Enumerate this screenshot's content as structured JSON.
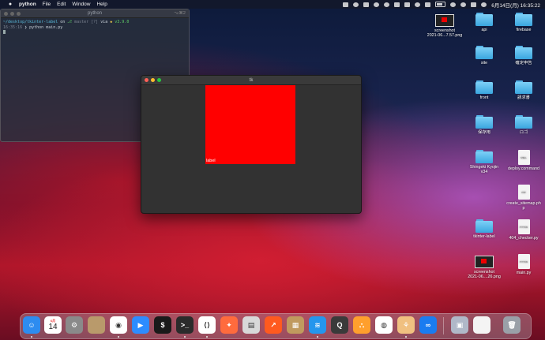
{
  "menubar": {
    "app_name": "python",
    "menus": [
      "File",
      "Edit",
      "Window",
      "Help"
    ],
    "clock": "6月14日(月)  16:35:22"
  },
  "terminal": {
    "title": "python",
    "shortcut": "⌥⌘2",
    "line1_path": "~/desktop/tkinter-label",
    "line1_on": " on ",
    "line1_branch": "master",
    "line1_flag": " [?]",
    "line1_via": " via ",
    "line1_version": "v3.9.0",
    "line2_time": "16:35:16",
    "line2_cmd": " ❯ python main.py"
  },
  "tk_window": {
    "title": "tk",
    "label_text": "label"
  },
  "desktop_icons": [
    {
      "name": "screenshot-file",
      "label": "screenshot\n2021-06...7.57.png",
      "kind": "shot",
      "col": 0,
      "row": 0
    },
    {
      "name": "folder-api",
      "label": "api",
      "kind": "folder",
      "col": 1,
      "row": 0
    },
    {
      "name": "folder-firebase",
      "label": "firebase",
      "kind": "folder",
      "col": 2,
      "row": 0
    },
    {
      "name": "folder-site",
      "label": "site",
      "kind": "folder",
      "col": 1,
      "row": 1
    },
    {
      "name": "folder-kakutei",
      "label": "確定申告",
      "kind": "folder",
      "col": 2,
      "row": 1
    },
    {
      "name": "folder-front",
      "label": "front",
      "kind": "folder",
      "col": 1,
      "row": 2
    },
    {
      "name": "folder-seikyu",
      "label": "請求書",
      "kind": "folder",
      "col": 2,
      "row": 2
    },
    {
      "name": "folder-hozon",
      "label": "保存用",
      "kind": "folder",
      "col": 1,
      "row": 3
    },
    {
      "name": "folder-logo",
      "label": "ロゴ",
      "kind": "folder",
      "col": 2,
      "row": 3
    },
    {
      "name": "folder-shingeki",
      "label": "Shingeki Kyojin\nv34",
      "kind": "folder",
      "col": 1,
      "row": 4
    },
    {
      "name": "file-deploy-command",
      "label": "deploy.command",
      "kind": "doc",
      "tag": "SHELL",
      "col": 2,
      "row": 4
    },
    {
      "name": "file-create-sitemap",
      "label": "create_sitemap.ph\np",
      "kind": "doc",
      "tag": "PHP",
      "col": 2,
      "row": 5
    },
    {
      "name": "folder-tkinter-label",
      "label": "tkinter-label",
      "kind": "folder",
      "col": 1,
      "row": 6
    },
    {
      "name": "file-404-checker",
      "label": "404_checker.py",
      "kind": "doc",
      "tag": "PYTHON",
      "col": 2,
      "row": 6
    },
    {
      "name": "screenshot-file-2",
      "label": "screenshot\n2021-06....26.png",
      "kind": "shot",
      "col": 1,
      "row": 7
    },
    {
      "name": "file-main-py",
      "label": "main.py",
      "kind": "doc",
      "tag": "PYTHON",
      "col": 2,
      "row": 7
    }
  ],
  "dock": {
    "calendar_month": "6月",
    "calendar_day": "14",
    "items": [
      {
        "name": "finder-icon",
        "color": "#2d8cf0",
        "glyph": "☺",
        "running": true
      },
      {
        "name": "calendar-icon",
        "color": "#ffffff",
        "glyph": "",
        "running": false
      },
      {
        "name": "system-preferences-icon",
        "color": "#8a8a8a",
        "glyph": "⚙",
        "running": false
      },
      {
        "name": "contacts-icon",
        "color": "#b99a6b",
        "glyph": "",
        "running": false
      },
      {
        "name": "chrome-icon",
        "color": "#ffffff",
        "glyph": "◉",
        "running": true
      },
      {
        "name": "zoom-icon",
        "color": "#2d8cff",
        "glyph": "▶",
        "running": false
      },
      {
        "name": "activity-monitor-icon",
        "color": "#1a1a1a",
        "glyph": "$",
        "running": false
      },
      {
        "name": "terminal-icon",
        "color": "#2b2b2b",
        "glyph": ">_",
        "running": true
      },
      {
        "name": "vscode-icon",
        "color": "#ffffff",
        "glyph": "⟨⟩",
        "running": true
      },
      {
        "name": "safari-icon",
        "color": "#ff6b3d",
        "glyph": "✦",
        "running": false
      },
      {
        "name": "sequel-icon",
        "color": "#d8d8d8",
        "glyph": "▤",
        "running": false
      },
      {
        "name": "monitor-chart-icon",
        "color": "#ff5a1f",
        "glyph": "↗",
        "running": false
      },
      {
        "name": "archive-icon",
        "color": "#c09a5e",
        "glyph": "▦",
        "running": false
      },
      {
        "name": "docker-icon",
        "color": "#2496ed",
        "glyph": "≋",
        "running": true
      },
      {
        "name": "quicktime-icon",
        "color": "#3a3a3a",
        "glyph": "Q",
        "running": false
      },
      {
        "name": "sourcetree-icon",
        "color": "#ff9f2d",
        "glyph": "⛬",
        "running": false
      },
      {
        "name": "postgres-icon",
        "color": "#ffffff",
        "glyph": "◍",
        "running": false
      },
      {
        "name": "python-launcher-icon",
        "color": "#f0c080",
        "glyph": "⚘",
        "running": true
      },
      {
        "name": "infinity-app-icon",
        "color": "#1a7cf0",
        "glyph": "∞",
        "running": false
      },
      {
        "name": "downloads-stack-icon",
        "color": "#b0b8c8",
        "glyph": "▣",
        "running": false
      },
      {
        "name": "document-stack-icon",
        "color": "#f4f4f4",
        "glyph": "",
        "running": false
      },
      {
        "name": "trash-icon",
        "color": "#9aa0a8",
        "glyph": "🗑",
        "running": false
      }
    ]
  }
}
